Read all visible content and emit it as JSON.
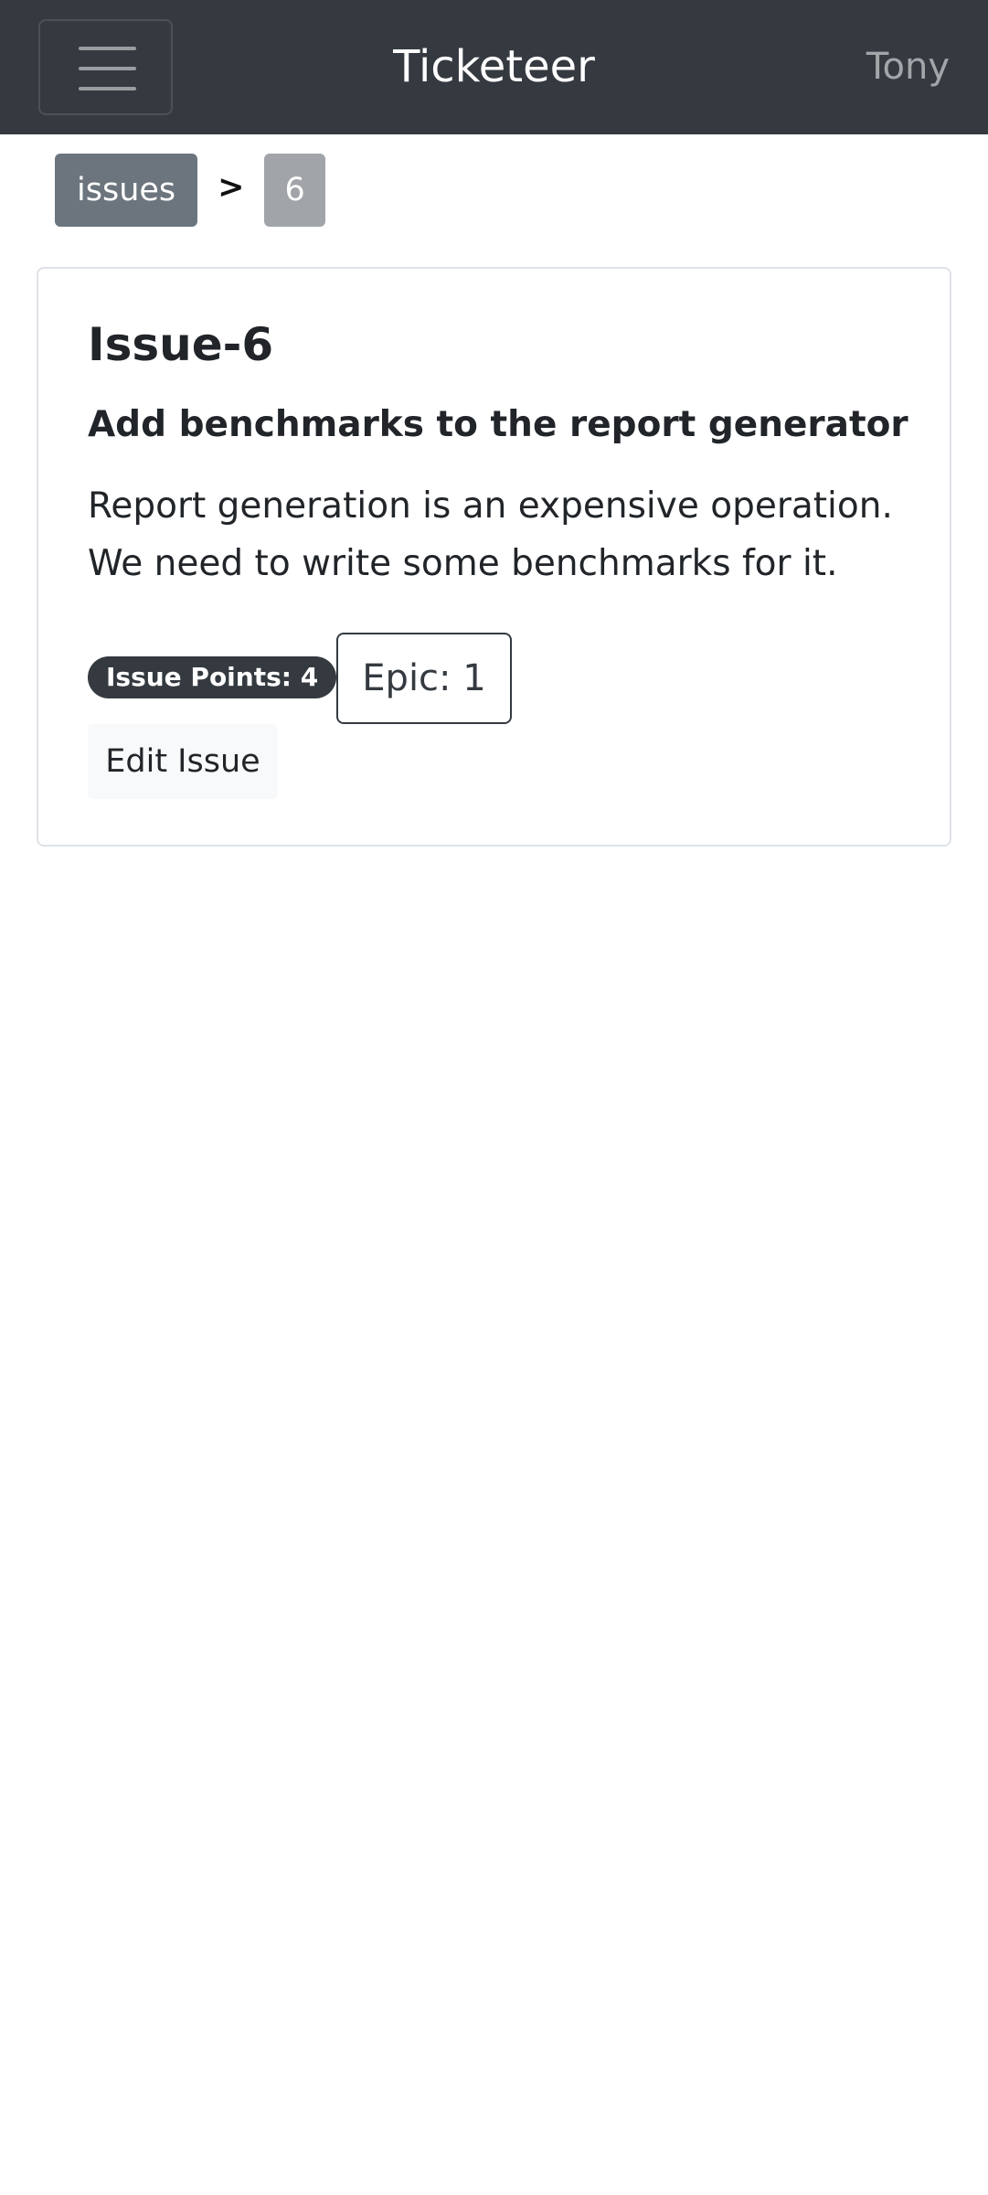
{
  "navbar": {
    "brand": "Ticketeer",
    "user": "Tony",
    "menu_icon": "hamburger-menu-icon"
  },
  "breadcrumb": {
    "parent": "issues",
    "separator": ">",
    "current": "6"
  },
  "issue": {
    "title": "Issue-6",
    "summary": "Add benchmarks to the report generator",
    "description": "Report generation is an expensive operation. We need to write some benchmarks for it.",
    "points_label": "Issue Points: 4",
    "epic_label": "Epic: 1",
    "edit_label": "Edit Issue"
  },
  "colors": {
    "navbar_bg": "#343a40",
    "breadcrumb_parent_bg": "#6c757d",
    "breadcrumb_current_bg": "#a1a5aa",
    "badge_bg": "#343a40"
  }
}
